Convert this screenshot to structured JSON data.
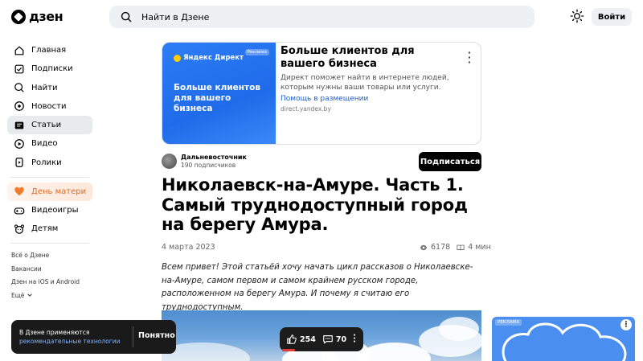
{
  "header": {
    "logo_text": "дзен",
    "search_placeholder": "Найти в Дзене",
    "login_label": "Войти"
  },
  "sidebar": {
    "items": [
      {
        "label": "Главная",
        "icon": "home-icon"
      },
      {
        "label": "Подписки",
        "icon": "subscriptions-icon"
      },
      {
        "label": "Найти",
        "icon": "search-icon"
      },
      {
        "label": "Новости",
        "icon": "news-icon"
      },
      {
        "label": "Статьи",
        "icon": "articles-icon",
        "active": true
      },
      {
        "label": "Видео",
        "icon": "video-icon"
      },
      {
        "label": "Ролики",
        "icon": "shorts-icon"
      }
    ],
    "special_items": [
      {
        "label": "День матери",
        "icon": "heart-icon",
        "color": "#e36a1f"
      },
      {
        "label": "Видеоигры",
        "icon": "gamepad-icon"
      },
      {
        "label": "Детям",
        "icon": "kids-icon"
      }
    ],
    "footer_links": [
      "Всё о Дзене",
      "Вакансии",
      "Дзен на iOS и Android",
      "Ещё"
    ]
  },
  "ad": {
    "brand": "Яндекс Директ",
    "badge": "Реклама",
    "image_text": "Больше клиентов для вашего бизнеса",
    "title": "Больше клиентов для вашего бизнеса",
    "description": "Директ поможет найти в интернете людей, которым нужны ваши товары или услуги.",
    "link": "Помощь в размещении",
    "domain": "direct.yandex.by"
  },
  "channel": {
    "name": "Дальневосточник",
    "subscribers": "190 подписчиков",
    "subscribe_label": "Подписаться"
  },
  "article": {
    "title": "Николаевск-на-Амуре. Часть 1. Самый труднодоступный город на берегу Амура.",
    "date": "4 марта 2023",
    "views": "6178",
    "read_time": "4 мин",
    "intro": "Всем привет! Этой статьёй хочу начать цикл рассказов о Николаевске-на-Амуре, самом первом и самом крайнем русском городе, расположенном на берегу Амура. И почему я считаю его труднодоступным."
  },
  "cookie": {
    "text": "В Дзене применяются",
    "link": "рекомендательные технологии",
    "button": "Понятно"
  },
  "actions": {
    "likes": "254",
    "comments": "70"
  },
  "side_ad": {
    "badge": "РЕКЛАМА"
  }
}
